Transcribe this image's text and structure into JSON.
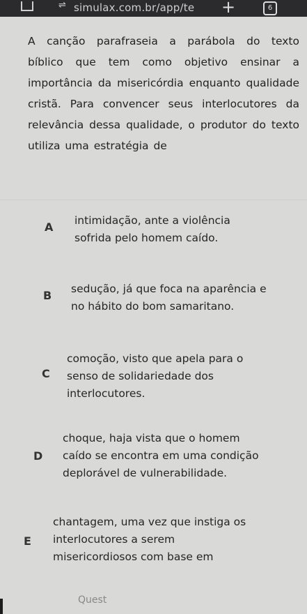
{
  "browser": {
    "url": "simulax.com.br/app/te",
    "new_tab": "+",
    "tab_count": "6"
  },
  "question": {
    "text": "A canção parafraseia a parábola do texto bíblico que tem como objetivo ensinar a importância da misericórdia enquanto qualidade cristã. Para convencer seus interlocutores da relevância dessa qualidade, o produtor do texto utiliza uma estratégia de"
  },
  "options": [
    {
      "letter": "A",
      "text": "intimidação, ante a violência sofrida pelo homem caído."
    },
    {
      "letter": "B",
      "text": "sedução, já que foca na aparência e no hábito do bom samaritano."
    },
    {
      "letter": "C",
      "text": "comoção, visto que apela para o senso de solidariedade dos interlocutores."
    },
    {
      "letter": "D",
      "text": "choque, haja vista que o homem caído se encontra em uma condição deplorável de vulnerabilidade."
    },
    {
      "letter": "E",
      "text": "chantagem, uma vez que instiga os interlocutores a serem misericordiosos com base em"
    }
  ],
  "footer": {
    "partial": "Quest"
  }
}
